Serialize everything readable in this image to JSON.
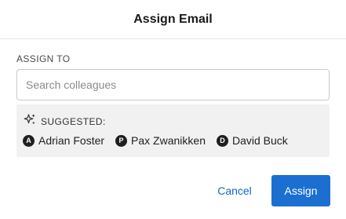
{
  "dialog": {
    "title": "Assign Email",
    "assign_to_label": "ASSIGN TO",
    "search": {
      "placeholder": "Search colleagues",
      "value": ""
    },
    "suggested": {
      "label": "SUGGESTED:",
      "icon": "sparkles-icon",
      "people": [
        {
          "initial": "A",
          "name": "Adrian Foster"
        },
        {
          "initial": "P",
          "name": "Pax Zwanikken"
        },
        {
          "initial": "D",
          "name": "David Buck"
        }
      ]
    },
    "buttons": {
      "cancel": "Cancel",
      "assign": "Assign"
    }
  },
  "colors": {
    "accent": "#1a6fd1",
    "link": "#1566c7",
    "suggested_bg": "#f1f1f1",
    "avatar_bg": "#1f1f1f"
  }
}
